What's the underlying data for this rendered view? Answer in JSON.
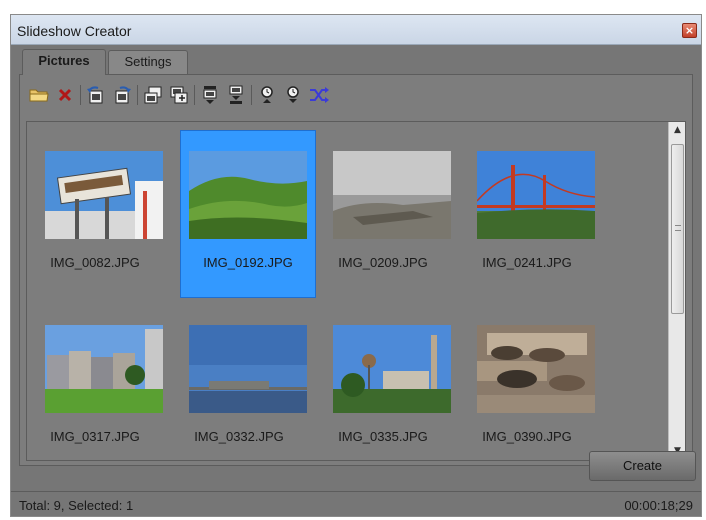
{
  "window": {
    "title": "Slideshow Creator"
  },
  "tabs": [
    {
      "label": "Pictures",
      "active": true
    },
    {
      "label": "Settings",
      "active": false
    }
  ],
  "toolbar": {
    "icons": [
      "folder-icon",
      "delete-icon",
      "rotate-left-icon",
      "rotate-right-icon",
      "move-up-icon",
      "move-down-icon",
      "move-first-icon",
      "move-last-icon",
      "duration-up-icon",
      "duration-down-icon",
      "shuffle-icon"
    ]
  },
  "pictures": [
    {
      "name": "IMG_0082.JPG",
      "selected": false
    },
    {
      "name": "IMG_0192.JPG",
      "selected": true
    },
    {
      "name": "IMG_0209.JPG",
      "selected": false
    },
    {
      "name": "IMG_0241.JPG",
      "selected": false
    },
    {
      "name": "IMG_0317.JPG",
      "selected": false
    },
    {
      "name": "IMG_0332.JPG",
      "selected": false
    },
    {
      "name": "IMG_0335.JPG",
      "selected": false
    },
    {
      "name": "IMG_0390.JPG",
      "selected": false
    }
  ],
  "buttons": {
    "create": "Create"
  },
  "status": {
    "summary": "Total: 9, Selected: 1",
    "duration": "00:00:18;29"
  },
  "colors": {
    "selection": "#3399ff",
    "panel": "#7d7d7d"
  }
}
